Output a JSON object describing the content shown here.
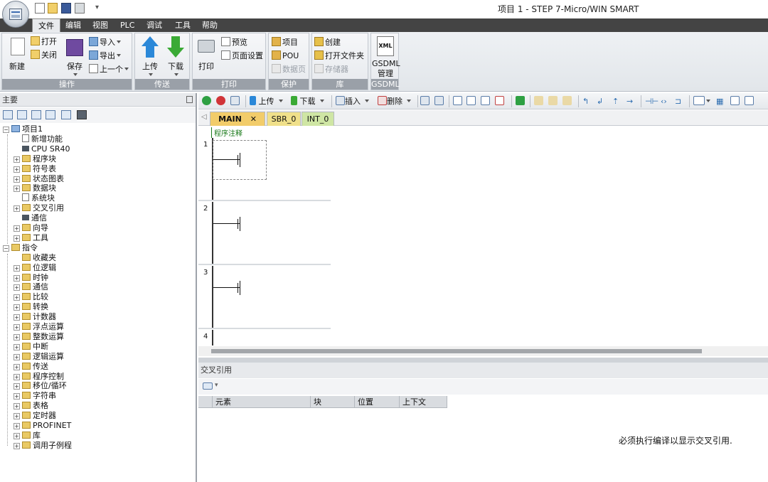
{
  "window": {
    "title": "项目 1 - STEP 7-Micro/WIN SMART"
  },
  "menu": [
    "文件",
    "编辑",
    "视图",
    "PLC",
    "调试",
    "工具",
    "帮助"
  ],
  "ribbon": {
    "operate": {
      "label": "操作",
      "new": "新建",
      "open": "打开",
      "close": "关闭",
      "save": "保存",
      "import": "导入",
      "export": "导出",
      "previous": "上一个"
    },
    "transfer": {
      "label": "传送",
      "upload": "上传",
      "download": "下载"
    },
    "print": {
      "label": "打印",
      "print": "打印",
      "preview": "预览",
      "page_setup": "页面设置"
    },
    "protect": {
      "label": "保护",
      "project": "项目",
      "pou": "POU",
      "data_page": "数据页"
    },
    "library": {
      "label": "库",
      "create": "创建",
      "open_folder": "打开文件夹",
      "memory": "存储器"
    },
    "gsdml": {
      "label": "GSDML",
      "btn": "GSDML\n管理",
      "icon_text": "XML"
    }
  },
  "left_panel": {
    "title": "主要",
    "tree": [
      {
        "label": "项目1",
        "level": 0,
        "exp": "⊟",
        "icon": "proj"
      },
      {
        "label": "新增功能",
        "level": 1,
        "exp": "",
        "icon": "doc"
      },
      {
        "label": "CPU SR40",
        "level": 1,
        "exp": "",
        "icon": "dot"
      },
      {
        "label": "程序块",
        "level": 1,
        "exp": "⊞",
        "icon": "fold"
      },
      {
        "label": "符号表",
        "level": 1,
        "exp": "⊞",
        "icon": "fold"
      },
      {
        "label": "状态图表",
        "level": 1,
        "exp": "⊞",
        "icon": "fold"
      },
      {
        "label": "数据块",
        "level": 1,
        "exp": "⊞",
        "icon": "fold"
      },
      {
        "label": "系统块",
        "level": 1,
        "exp": "",
        "icon": "doc"
      },
      {
        "label": "交叉引用",
        "level": 1,
        "exp": "⊞",
        "icon": "fold"
      },
      {
        "label": "通信",
        "level": 1,
        "exp": "",
        "icon": "dot"
      },
      {
        "label": "向导",
        "level": 1,
        "exp": "⊞",
        "icon": "fold"
      },
      {
        "label": "工具",
        "level": 1,
        "exp": "⊞",
        "icon": "fold"
      },
      {
        "label": "指令",
        "level": 0,
        "exp": "⊟",
        "icon": "fold"
      },
      {
        "label": "收藏夹",
        "level": 1,
        "exp": "",
        "icon": "fold"
      },
      {
        "label": "位逻辑",
        "level": 1,
        "exp": "⊞",
        "icon": "fold"
      },
      {
        "label": "时钟",
        "level": 1,
        "exp": "⊞",
        "icon": "fold"
      },
      {
        "label": "通信",
        "level": 1,
        "exp": "⊞",
        "icon": "fold"
      },
      {
        "label": "比较",
        "level": 1,
        "exp": "⊞",
        "icon": "fold"
      },
      {
        "label": "转换",
        "level": 1,
        "exp": "⊞",
        "icon": "fold"
      },
      {
        "label": "计数器",
        "level": 1,
        "exp": "⊞",
        "icon": "fold"
      },
      {
        "label": "浮点运算",
        "level": 1,
        "exp": "⊞",
        "icon": "fold"
      },
      {
        "label": "整数运算",
        "level": 1,
        "exp": "⊞",
        "icon": "fold"
      },
      {
        "label": "中断",
        "level": 1,
        "exp": "⊞",
        "icon": "fold"
      },
      {
        "label": "逻辑运算",
        "level": 1,
        "exp": "⊞",
        "icon": "fold"
      },
      {
        "label": "传送",
        "level": 1,
        "exp": "⊞",
        "icon": "fold"
      },
      {
        "label": "程序控制",
        "level": 1,
        "exp": "⊞",
        "icon": "fold"
      },
      {
        "label": "移位/循环",
        "level": 1,
        "exp": "⊞",
        "icon": "fold"
      },
      {
        "label": "字符串",
        "level": 1,
        "exp": "⊞",
        "icon": "fold"
      },
      {
        "label": "表格",
        "level": 1,
        "exp": "⊞",
        "icon": "fold"
      },
      {
        "label": "定时器",
        "level": 1,
        "exp": "⊞",
        "icon": "fold"
      },
      {
        "label": "PROFINET",
        "level": 1,
        "exp": "⊞",
        "icon": "fold"
      },
      {
        "label": "库",
        "level": 1,
        "exp": "⊞",
        "icon": "fold"
      },
      {
        "label": "调用子例程",
        "level": 1,
        "exp": "⊞",
        "icon": "fold"
      }
    ]
  },
  "editor_toolbar": {
    "upload": "上传",
    "download": "下载",
    "insert": "插入",
    "delete": "删除"
  },
  "tabs": [
    {
      "label": "MAIN",
      "color": "#f2cc6a",
      "close": "✕"
    },
    {
      "label": "SBR_0",
      "color": "#f0e08a"
    },
    {
      "label": "INT_0",
      "color": "#cfe6a4"
    }
  ],
  "editor": {
    "program_comment": "程序注释",
    "networks": [
      "1",
      "2",
      "3",
      "4"
    ]
  },
  "xref": {
    "title": "交叉引用",
    "columns": [
      "元素",
      "块",
      "位置",
      "上下文"
    ],
    "message": "必须执行编译以显示交叉引用."
  }
}
